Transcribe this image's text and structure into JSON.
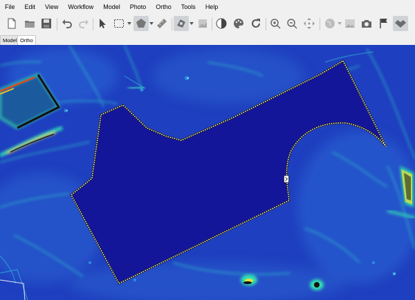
{
  "menu": [
    "File",
    "Edit",
    "View",
    "Workflow",
    "Model",
    "Photo",
    "Ortho",
    "Tools",
    "Help"
  ],
  "tabs": [
    {
      "label": "Model",
      "active": false
    },
    {
      "label": "Ortho",
      "active": true
    }
  ],
  "toolbar_icons": [
    "new-document-icon",
    "open-folder-icon",
    "save-icon",
    "undo-icon",
    "redo-icon",
    "navigation-arrow-icon",
    "rectangle-selection-icon",
    "polygon-draw-icon",
    "ruler-icon",
    "patch-icon",
    "dem-layer-icon",
    "shading-icon",
    "palette-icon",
    "refresh-icon",
    "zoom-in-icon",
    "zoom-out-icon",
    "move-icon",
    "globe-icon",
    "image-icon",
    "camera-icon",
    "marker-flag-icon",
    "handshake-icon"
  ],
  "colors": {
    "chrome_bg": "#f0f0f0",
    "map_base": "#1e3fbf",
    "polygon_fill": "#14169a",
    "highlight": "#1fd6b4",
    "outline": "#ffffe0"
  }
}
